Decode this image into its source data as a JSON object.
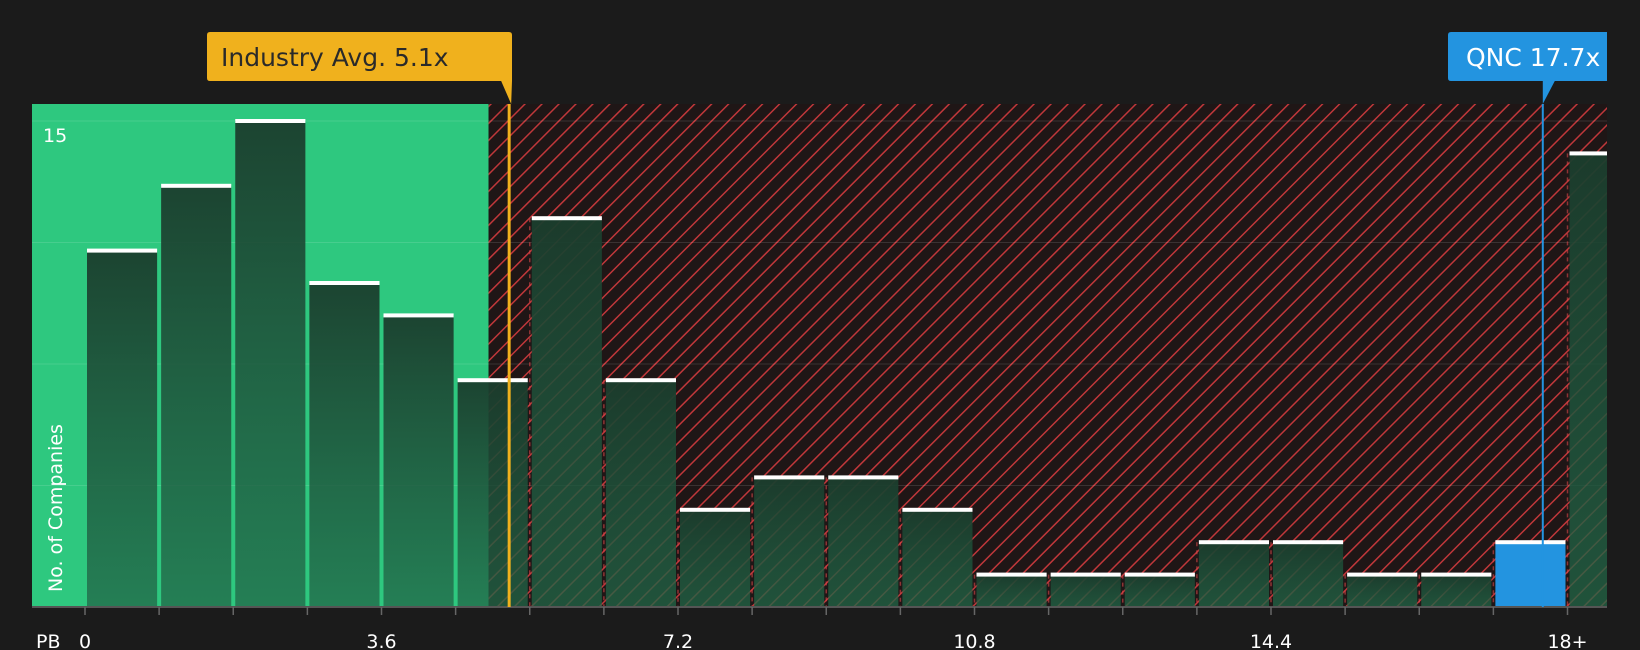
{
  "chart_data": {
    "type": "bar",
    "x_axis_label": "PB",
    "y_axis_label": "No. of Companies",
    "x_tick_labels": [
      "0",
      "3.6",
      "7.2",
      "10.8",
      "14.4",
      "18+"
    ],
    "x_ticks": [
      0,
      3.6,
      7.2,
      10.8,
      14.4,
      18
    ],
    "y_tick_labels": [
      "15"
    ],
    "y_ticks": [
      15
    ],
    "gridlines_y": [
      3.75,
      7.5,
      11.25,
      15
    ],
    "xlim": [
      -0.65,
      18.45
    ],
    "ylim": [
      0,
      15.5
    ],
    "bin_width": 0.9,
    "bins": [
      {
        "x_start": 0.0,
        "count": 11
      },
      {
        "x_start": 0.9,
        "count": 13
      },
      {
        "x_start": 1.8,
        "count": 15
      },
      {
        "x_start": 2.7,
        "count": 10
      },
      {
        "x_start": 3.6,
        "count": 9
      },
      {
        "x_start": 4.5,
        "count": 7
      },
      {
        "x_start": 5.4,
        "count": 12
      },
      {
        "x_start": 6.3,
        "count": 7
      },
      {
        "x_start": 7.2,
        "count": 3
      },
      {
        "x_start": 8.1,
        "count": 4
      },
      {
        "x_start": 9.0,
        "count": 4
      },
      {
        "x_start": 9.9,
        "count": 3
      },
      {
        "x_start": 10.8,
        "count": 1
      },
      {
        "x_start": 11.7,
        "count": 1
      },
      {
        "x_start": 12.6,
        "count": 1
      },
      {
        "x_start": 13.5,
        "count": 2
      },
      {
        "x_start": 14.4,
        "count": 2
      },
      {
        "x_start": 15.3,
        "count": 1
      },
      {
        "x_start": 16.2,
        "count": 1
      },
      {
        "x_start": 17.1,
        "count": 2,
        "highlight": true
      },
      {
        "x_start": 18.0,
        "count": 14
      }
    ],
    "fair_zone_end": 4.9,
    "industry_avg": {
      "label": "Industry Avg. 5.1x",
      "value": 5.15
    },
    "company": {
      "label": "QNC 17.7x",
      "value": 17.7
    },
    "colors": {
      "background": "#1b1b1b",
      "fair_zone": "#2ec87f",
      "overvalued_zone": "#b03232",
      "bar_fill": "#1e3c2e",
      "bar_cap": "#ffffff",
      "industry_avg": "#f0b11d",
      "company": "#2394e0"
    }
  }
}
